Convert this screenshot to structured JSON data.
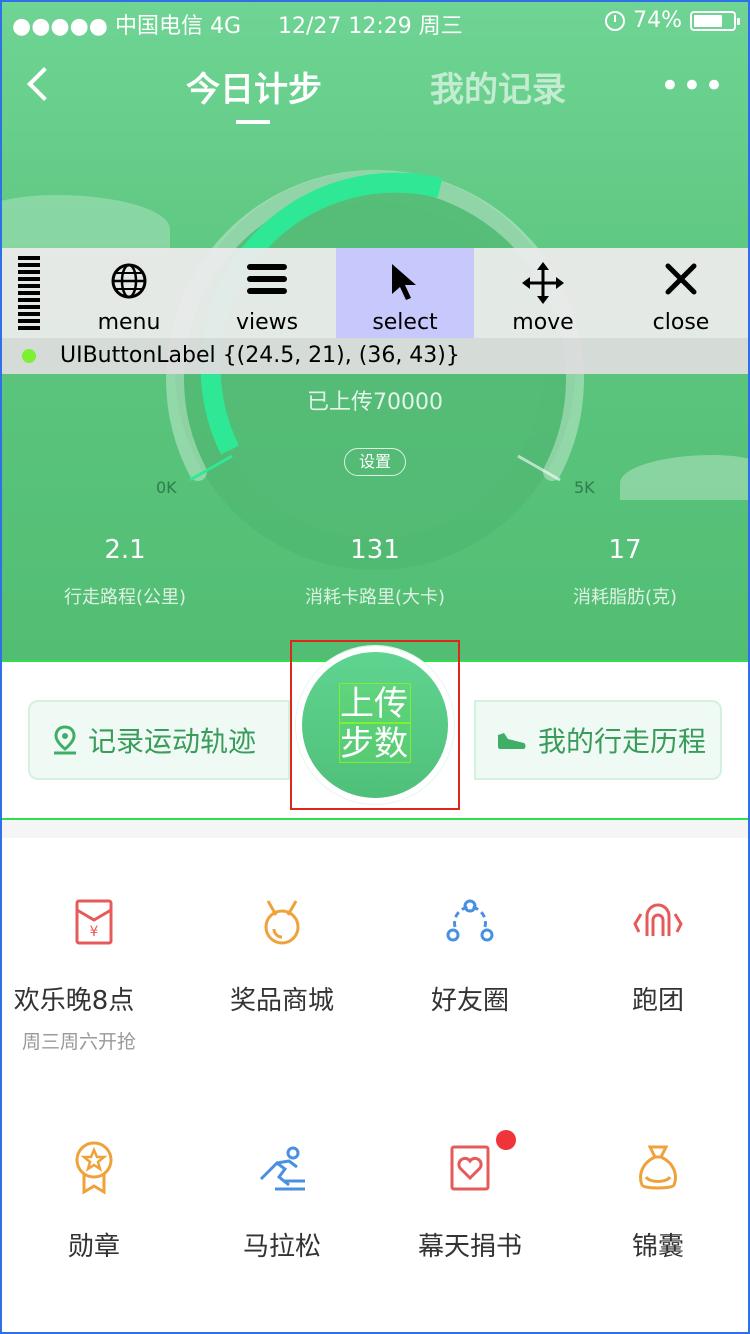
{
  "status_bar": {
    "carrier": "●●●●● 中国电信  4G",
    "datetime": "12/27 12:29 周三",
    "battery": "74%",
    "battery_level": 0.74
  },
  "nav": {
    "tab_active": "今日计步",
    "tab_inactive": "我的记录",
    "more": "•••"
  },
  "gauge": {
    "uploaded": "已上传70000",
    "settings": "设置",
    "min_label": "0K",
    "max_label": "5K"
  },
  "stats": [
    {
      "value": "2.1",
      "label": "行走路程(公里)"
    },
    {
      "value": "131",
      "label": "消耗卡路里(大卡)"
    },
    {
      "value": "17",
      "label": "消耗脂肪(克)"
    }
  ],
  "debug_toolbar": {
    "buttons": [
      {
        "label": "menu",
        "icon": "globe-icon"
      },
      {
        "label": "views",
        "icon": "hamburger-icon"
      },
      {
        "label": "select",
        "icon": "cursor-arrow-icon"
      },
      {
        "label": "move",
        "icon": "move-arrows-icon"
      },
      {
        "label": "close",
        "icon": "close-x-icon"
      }
    ],
    "selected": "select",
    "info": "UIButtonLabel {(24.5, 21), (36, 43)}"
  },
  "actions": {
    "left": "记录运动轨迹",
    "right": "我的行走历程",
    "upload_line1": "上传",
    "upload_line2": "步数"
  },
  "grid": [
    {
      "label": "欢乐晚8点",
      "sub": "周三周六开抢",
      "icon": "red-envelope-icon",
      "color": "#e65a5a"
    },
    {
      "label": "奖品商城",
      "icon": "medal-icon",
      "color": "#f0a23a"
    },
    {
      "label": "好友圈",
      "icon": "friends-circle-icon",
      "color": "#4a90e2"
    },
    {
      "label": "跑团",
      "icon": "running-group-icon",
      "color": "#e65a5a"
    },
    {
      "label": "勋章",
      "icon": "badge-icon",
      "color": "#f0a23a"
    },
    {
      "label": "马拉松",
      "icon": "runner-icon",
      "color": "#4a90e2"
    },
    {
      "label": "幕天捐书",
      "icon": "heart-book-icon",
      "color": "#e65a5a",
      "badge": true
    },
    {
      "label": "锦囊",
      "icon": "money-bag-icon",
      "color": "#f0a23a"
    }
  ],
  "colors": {
    "brand_green": "#5cc67f",
    "accent_green": "#2fe896",
    "selection_red": "#e0261b",
    "debug_select": "#c7c8fb"
  }
}
